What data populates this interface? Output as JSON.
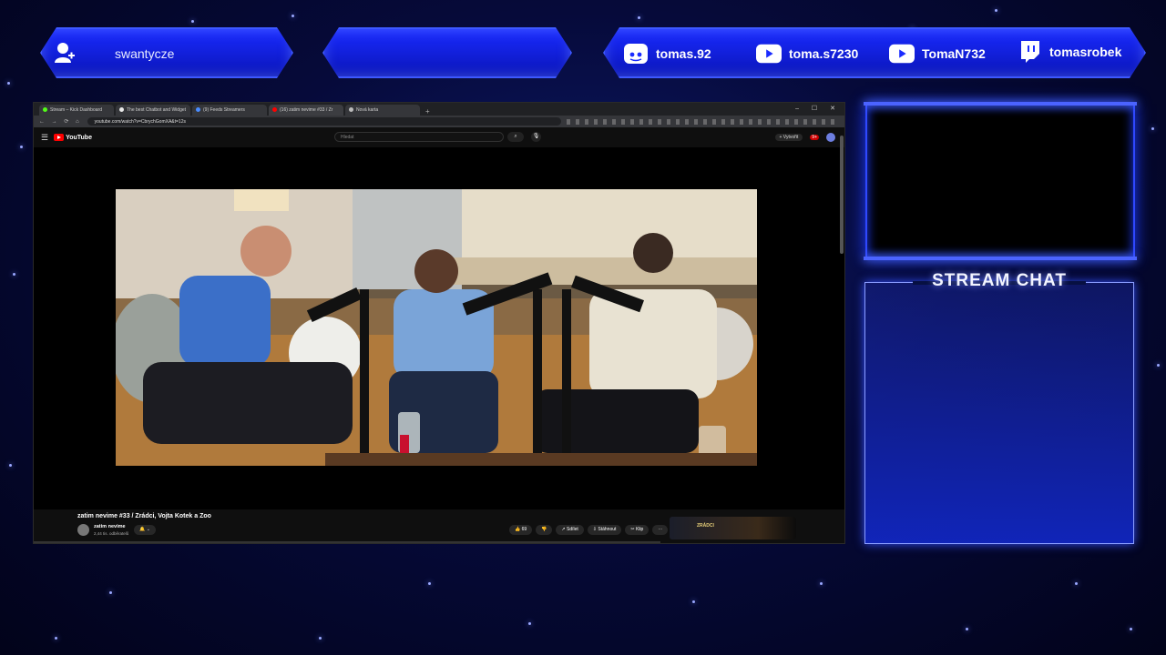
{
  "user": {
    "name": "swantycze"
  },
  "socials": [
    {
      "platform": "discord-icon",
      "handle": "tomas.92"
    },
    {
      "platform": "youtube-icon",
      "handle": "toma.s7230"
    },
    {
      "platform": "youtube-icon",
      "handle": "TomaN732"
    },
    {
      "platform": "twitch-icon",
      "handle": "tomasrobek"
    }
  ],
  "browser": {
    "tabs": [
      {
        "label": "Stream – Kick Dashboard",
        "color": "#53fc18"
      },
      {
        "label": "The best Chatbot and Widget",
        "color": "#e8e8e8"
      },
      {
        "label": "(9) Feeds Streamers",
        "color": "#4a8cff"
      },
      {
        "label": "(16) zatim nevime #33 / Zr",
        "color": "#ff0000"
      },
      {
        "label": "Nová karta",
        "color": "#bbbbbb"
      }
    ],
    "new_tab": "+",
    "window_controls": "– ☐ ✕",
    "nav": "← → ⟳ ⌂",
    "url": "youtube.com/watch?v=CbrychGomXA&t=12s"
  },
  "youtube": {
    "logo_text": "YouTube",
    "search_placeholder": "Hledat",
    "create_label": "+ Vytvořit",
    "notifications": "9+",
    "video_title": "zatim nevime #33 / Zrádci, Vojta Kotek a Zoo",
    "channel_name": "zatim nevime",
    "channel_subs": "2,44 tis. odběratelů",
    "bell": "🔔 ⌄",
    "likes": "👍 69",
    "dislike": "👎",
    "share": "↗ Sdílet",
    "download": "⇩ Stáhnout",
    "clip": "✂ Klip",
    "more": "⋯",
    "recommended_title": "ZRÁDCI"
  },
  "panels": {
    "chat_title": "STREAM CHAT"
  },
  "colors": {
    "accent": "#1a2bff",
    "glow": "#2540ff",
    "youtube_red": "#ff0000",
    "chat_bg": "#1228c8"
  }
}
